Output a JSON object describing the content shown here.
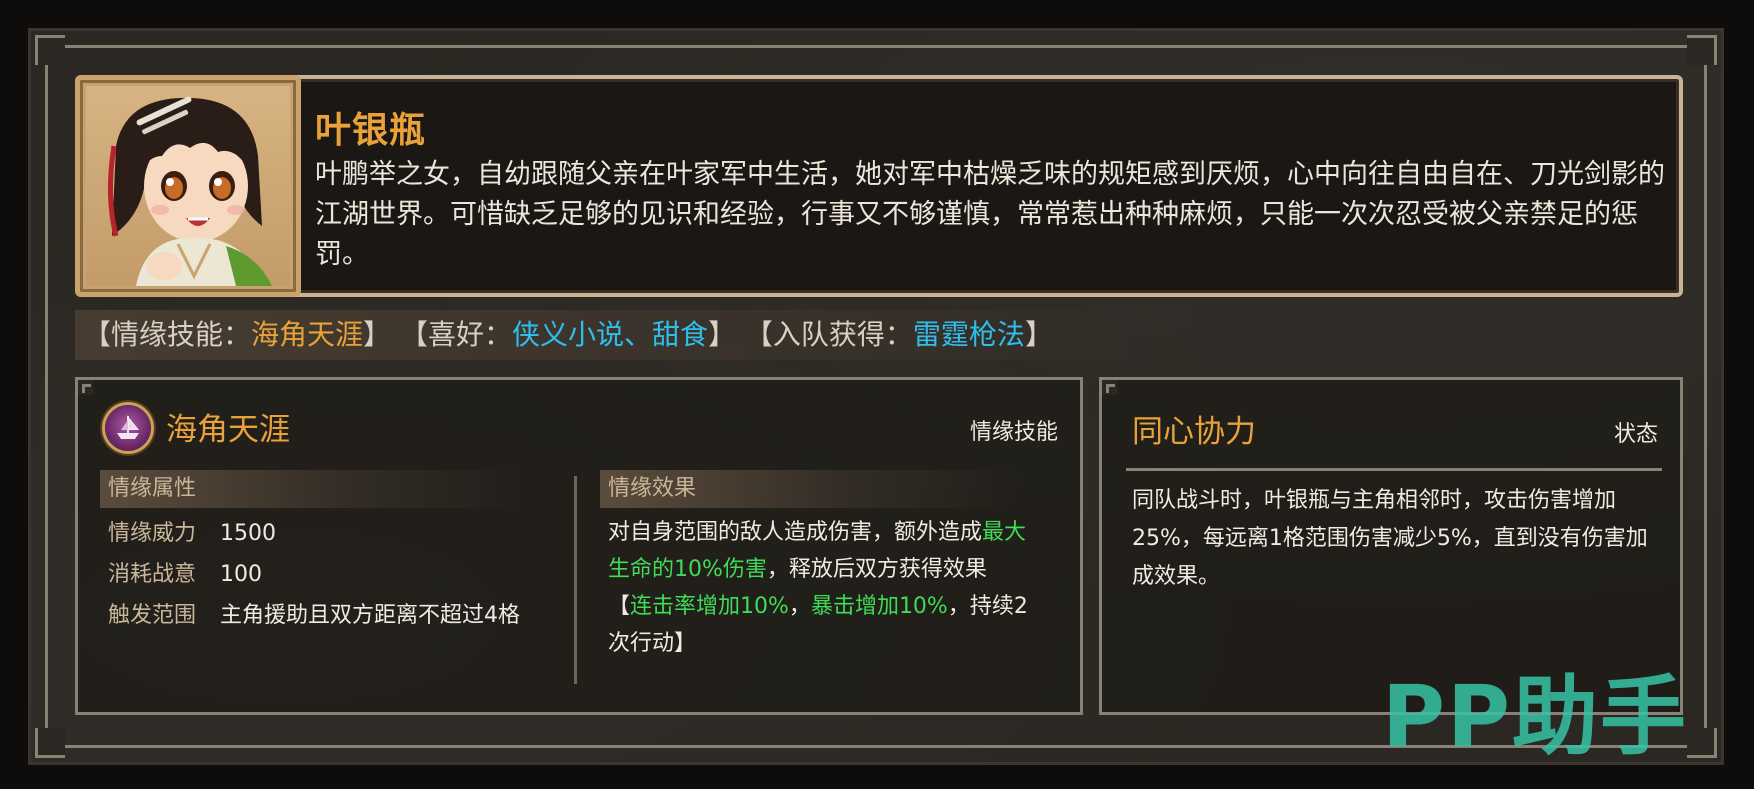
{
  "character": {
    "name": "叶银瓶",
    "bio": "叶鹏举之女，自幼跟随父亲在叶家军中生活，她对军中枯燥乏味的规矩感到厌烦，心中向往自由自在、刀光剑影的江湖世界。可惜缺乏足够的见识和经验，行事又不够谨慎，常常惹出种种麻烦，只能一次次忍受被父亲禁足的惩罚。"
  },
  "info_strip": {
    "skill_prefix": "【情缘技能：",
    "skill_name": "海角天涯",
    "skill_suffix": "】",
    "hobby_prefix": "【喜好：",
    "hobby_value": "侠义小说、甜食",
    "hobby_suffix": "】",
    "join_prefix": "【入队获得：",
    "join_value": "雷霆枪法",
    "join_suffix": "】"
  },
  "skill_panel": {
    "title": "海角天涯",
    "type_label": "情缘技能",
    "attributes_header": "情缘属性",
    "attributes": [
      {
        "key": "情缘威力",
        "value": "1500"
      },
      {
        "key": "消耗战意",
        "value": "100"
      },
      {
        "key": "触发范围",
        "value": "主角援助且双方距离不超过4格"
      }
    ],
    "effect_header": "情缘效果",
    "effect": {
      "part1": "对自身范围的敌人造成伤害，额外造成",
      "highlight1": "最大生命的10%伤害",
      "part2": "，释放后双方获得效果【",
      "highlight2": "连击率增加10%",
      "part3": "，",
      "highlight3": "暴击增加10%",
      "part4": "，持续2次行动】"
    }
  },
  "status_panel": {
    "title": "同心协力",
    "type_label": "状态",
    "description": "同队战斗时，叶银瓶与主角相邻时，攻击伤害增加25%，每远离1格范围伤害减少5%，直到没有伤害加成效果。"
  },
  "watermark": "PP助手",
  "colors": {
    "accent_gold": "#e9a23a",
    "accent_cyan": "#2fbde9",
    "highlight_green": "#3fdc55",
    "frame": "#8a8174",
    "background": "#2b2722"
  }
}
